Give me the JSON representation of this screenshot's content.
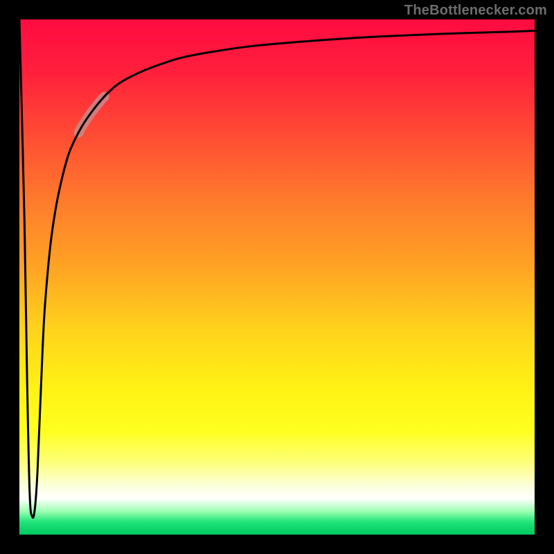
{
  "watermark": {
    "text": "TheBottlenecker.com"
  },
  "colors": {
    "frame": "#000000",
    "curve": "#000000",
    "highlight": "#c78b8b",
    "gradient_stops": [
      {
        "offset": 0.0,
        "color": "#ff0b40"
      },
      {
        "offset": 0.1,
        "color": "#ff1f3c"
      },
      {
        "offset": 0.22,
        "color": "#ff4a34"
      },
      {
        "offset": 0.35,
        "color": "#ff7a2c"
      },
      {
        "offset": 0.48,
        "color": "#ffa324"
      },
      {
        "offset": 0.6,
        "color": "#ffd21c"
      },
      {
        "offset": 0.72,
        "color": "#fff314"
      },
      {
        "offset": 0.8,
        "color": "#ffff20"
      },
      {
        "offset": 0.86,
        "color": "#fdff7a"
      },
      {
        "offset": 0.905,
        "color": "#fbffda"
      },
      {
        "offset": 0.93,
        "color": "#ffffff"
      },
      {
        "offset": 0.955,
        "color": "#9bffb0"
      },
      {
        "offset": 0.975,
        "color": "#22e47a"
      },
      {
        "offset": 1.0,
        "color": "#00c760"
      }
    ]
  },
  "chart_data": {
    "type": "line",
    "title": "",
    "xlabel": "",
    "ylabel": "",
    "xlim": [
      0,
      100
    ],
    "ylim": [
      0,
      100
    ],
    "legend": false,
    "grid": false,
    "series": [
      {
        "name": "bottleneck-curve",
        "x": [
          0,
          1,
          1.5,
          2,
          2.5,
          3,
          3.5,
          4,
          4.5,
          5,
          6,
          7,
          8,
          9,
          10,
          12,
          14,
          16,
          18,
          20,
          24,
          28,
          32,
          38,
          45,
          55,
          65,
          75,
          85,
          95,
          100
        ],
        "y": [
          100,
          60,
          30,
          8,
          3.5,
          5,
          12,
          24,
          36,
          45,
          56,
          63,
          68,
          72,
          75,
          79,
          82,
          84.5,
          86.5,
          88,
          90,
          91.5,
          92.7,
          93.8,
          94.8,
          95.7,
          96.4,
          96.9,
          97.3,
          97.6,
          97.8
        ]
      }
    ],
    "annotations": [
      {
        "name": "highlight-segment",
        "x_range": [
          11.5,
          16.5
        ],
        "style": "thick-muted"
      }
    ]
  }
}
